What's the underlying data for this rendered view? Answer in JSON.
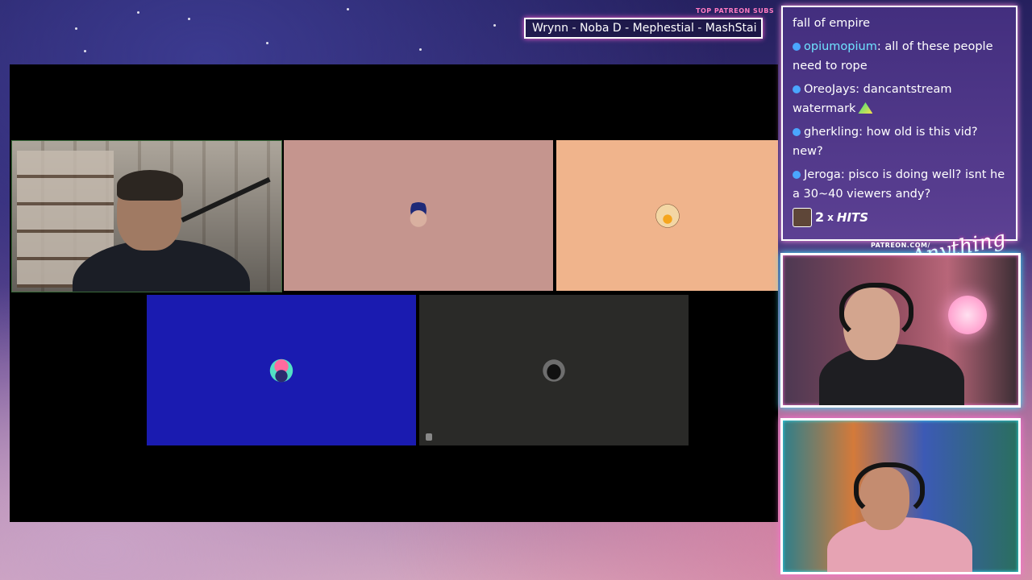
{
  "ticker": {
    "label": "TOP PATREON SUBS",
    "names": "Wrynn -  Noba D - Mephestial - MashStai"
  },
  "chat": {
    "messages": [
      {
        "user": "",
        "text": "fall of empire",
        "badge": false
      },
      {
        "user": "opiumopium",
        "text": ": all of these people need to rope",
        "badge": true,
        "user_color": "teal"
      },
      {
        "user": "OreoJays",
        "text": ": dancantstream watermark",
        "badge": true,
        "emote": true
      },
      {
        "user": "gherkling",
        "text": ": how old is this vid? new?",
        "badge": true
      },
      {
        "user": "Jeroga",
        "text": ": pisco is doing well? isnt he a 30~40 viewers andy?",
        "badge": true
      }
    ],
    "hits": {
      "count": "2",
      "x": "x",
      "word": "HITS"
    }
  },
  "branding": {
    "patreon": "PATREON.COM/",
    "logo": "Anything Else?"
  },
  "video_call": {
    "tiles": [
      {
        "type": "camera",
        "color": "#1a1a1a",
        "avatar": "webcam-person"
      },
      {
        "type": "avatar",
        "color": "#c5958e",
        "avatar": "hat-avatar-icon"
      },
      {
        "type": "avatar",
        "color": "#f0b48c",
        "avatar": "duck-avatar-icon"
      },
      {
        "type": "avatar",
        "color": "#1a1bb0",
        "avatar": "pink-hair-avatar-icon"
      },
      {
        "type": "avatar",
        "color": "#2a2a28",
        "avatar": "helmet-avatar-icon"
      }
    ]
  }
}
